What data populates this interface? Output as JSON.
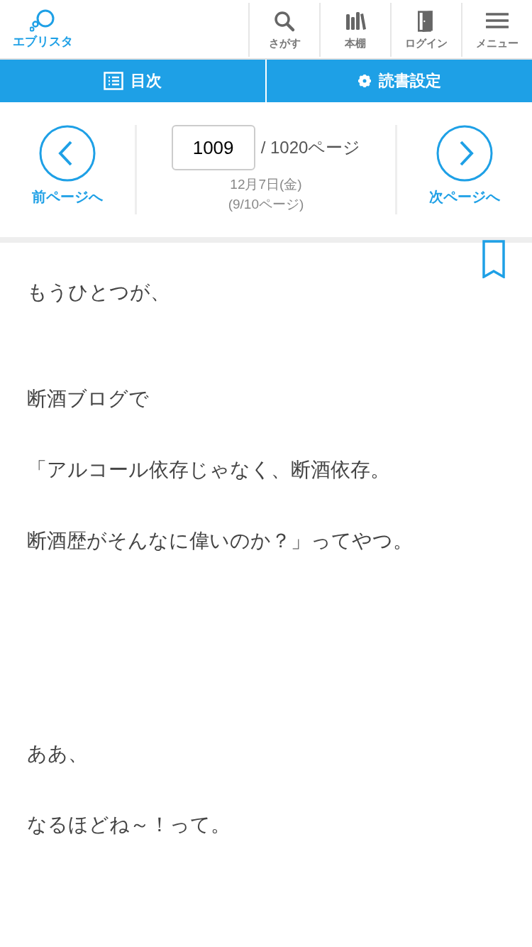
{
  "header": {
    "logo_text": "エブリスタ",
    "nav": [
      {
        "kind": "search",
        "label": "さがす"
      },
      {
        "kind": "shelf",
        "label": "本棚"
      },
      {
        "kind": "login",
        "label": "ログイン"
      },
      {
        "kind": "menu",
        "label": "メニュー"
      }
    ]
  },
  "action_bar": [
    {
      "kind": "toc",
      "label": "目次"
    },
    {
      "kind": "settings",
      "label": "読書設定"
    }
  ],
  "pager": {
    "prev_label": "前ページへ",
    "next_label": "次ページへ",
    "page_value": "1009",
    "total": "/ 1020ページ",
    "date": "12月7日(金)",
    "sub_page": "(9/10ページ)"
  },
  "body": [
    {
      "kind": "text",
      "text": "もうひとつが、"
    },
    {
      "kind": "blank"
    },
    {
      "kind": "blank"
    },
    {
      "kind": "text",
      "text": "断酒ブログで"
    },
    {
      "kind": "blank"
    },
    {
      "kind": "text",
      "text": "「アルコール依存じゃなく、断酒依存。"
    },
    {
      "kind": "blank"
    },
    {
      "kind": "text",
      "text": "断酒歴がそんなに偉いのか？」ってやつ。"
    },
    {
      "kind": "blank"
    },
    {
      "kind": "blank"
    },
    {
      "kind": "blank"
    },
    {
      "kind": "blank"
    },
    {
      "kind": "blank"
    },
    {
      "kind": "text",
      "text": "ああ、"
    },
    {
      "kind": "blank"
    },
    {
      "kind": "text",
      "text": "なるほどね～！って。"
    }
  ]
}
